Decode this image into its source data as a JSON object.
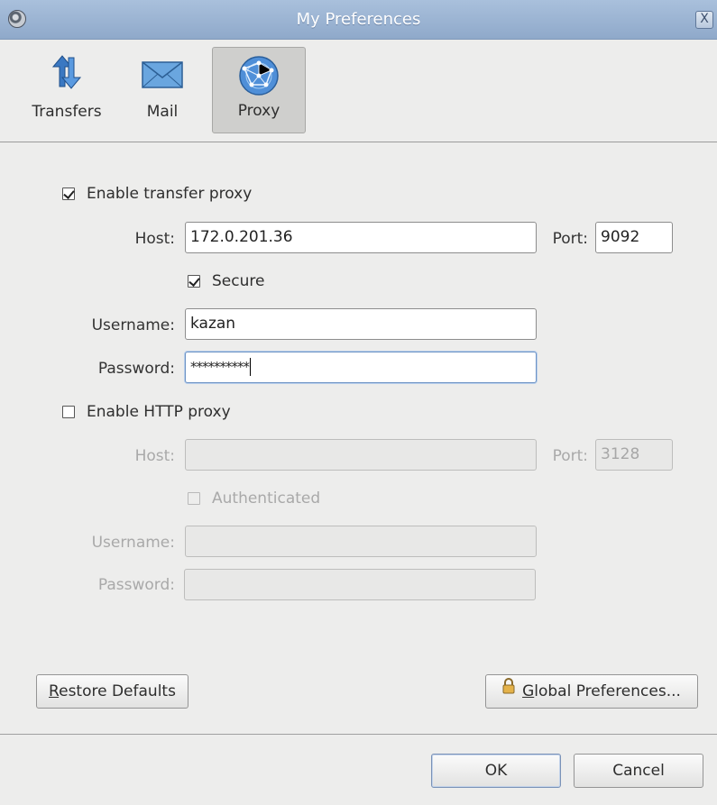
{
  "window": {
    "title": "My Preferences",
    "close_glyph": "X"
  },
  "toolbar": {
    "items": [
      {
        "label": "Transfers",
        "icon": "transfer-arrows-icon"
      },
      {
        "label": "Mail",
        "icon": "envelope-icon"
      },
      {
        "label": "Proxy",
        "icon": "globe-network-icon",
        "active": true
      }
    ]
  },
  "transfer_proxy": {
    "enable_label": "Enable transfer proxy",
    "enabled": true,
    "host_label": "Host:",
    "host_value": "172.0.201.36",
    "port_label": "Port:",
    "port_value": "9092",
    "secure_label": "Secure",
    "secure": true,
    "username_label": "Username:",
    "username_value": "kazan",
    "password_label": "Password:",
    "password_value": "**********"
  },
  "http_proxy": {
    "enable_label": "Enable HTTP proxy",
    "enabled": false,
    "host_label": "Host:",
    "host_value": "",
    "port_label": "Port:",
    "port_value": "3128",
    "auth_label": "Authenticated",
    "authenticated": false,
    "username_label": "Username:",
    "username_value": "",
    "password_label": "Password:",
    "password_value": ""
  },
  "buttons": {
    "restore_first": "R",
    "restore_rest": "estore Defaults",
    "global_first": "G",
    "global_rest": "lobal Preferences...",
    "ok": "OK",
    "cancel": "Cancel"
  },
  "colors": {
    "titlebar": "#9bb3d3",
    "accent_focus": "#6d93c4",
    "background": "#ededec"
  }
}
